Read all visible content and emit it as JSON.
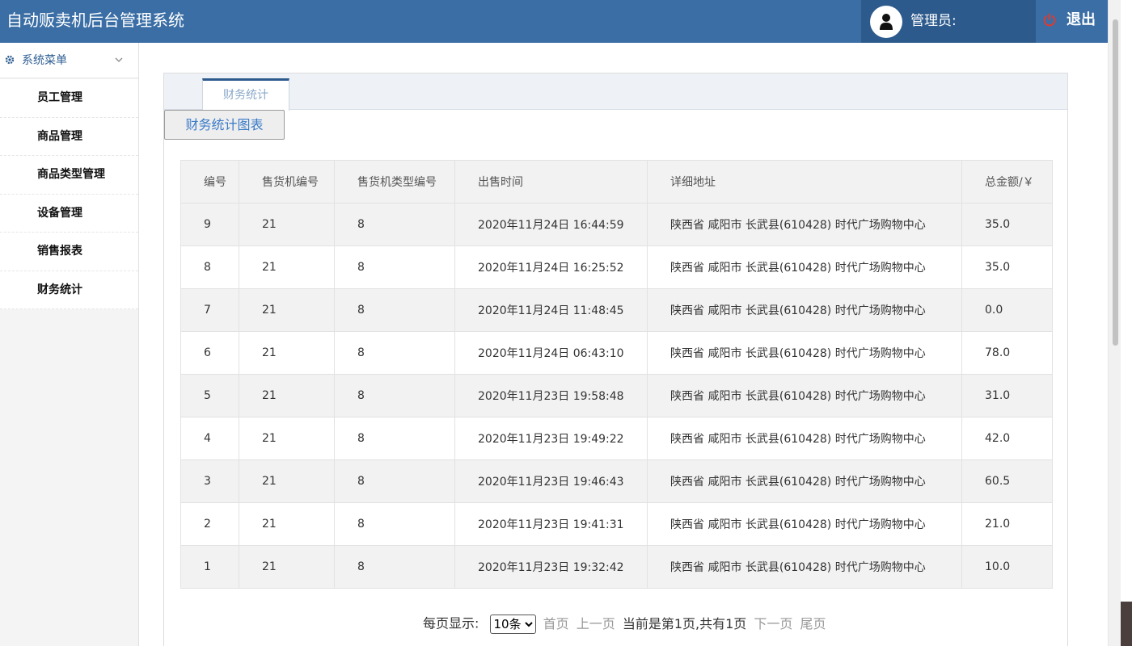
{
  "header": {
    "title": "自动贩卖机后台管理系统",
    "user_label": "管理员:",
    "logout_label": "退出"
  },
  "sidebar": {
    "menu_title": "系统菜单",
    "items": [
      {
        "label": "员工管理"
      },
      {
        "label": "商品管理"
      },
      {
        "label": "商品类型管理"
      },
      {
        "label": "设备管理"
      },
      {
        "label": "销售报表"
      },
      {
        "label": "财务统计"
      }
    ]
  },
  "tab": {
    "label": "财务统计"
  },
  "chart_button_label": "财务统计图表",
  "table": {
    "headers": [
      "编号",
      "售货机编号",
      "售货机类型编号",
      "出售时间",
      "详细地址",
      "总金额/￥"
    ],
    "rows": [
      [
        "9",
        "21",
        "8",
        "2020年11月24日 16:44:59",
        "陕西省 咸阳市 长武县(610428) 时代广场购物中心",
        "35.0"
      ],
      [
        "8",
        "21",
        "8",
        "2020年11月24日 16:25:52",
        "陕西省 咸阳市 长武县(610428) 时代广场购物中心",
        "35.0"
      ],
      [
        "7",
        "21",
        "8",
        "2020年11月24日 11:48:45",
        "陕西省 咸阳市 长武县(610428) 时代广场购物中心",
        "0.0"
      ],
      [
        "6",
        "21",
        "8",
        "2020年11月24日 06:43:10",
        "陕西省 咸阳市 长武县(610428) 时代广场购物中心",
        "78.0"
      ],
      [
        "5",
        "21",
        "8",
        "2020年11月23日 19:58:48",
        "陕西省 咸阳市 长武县(610428) 时代广场购物中心",
        "31.0"
      ],
      [
        "4",
        "21",
        "8",
        "2020年11月23日 19:49:22",
        "陕西省 咸阳市 长武县(610428) 时代广场购物中心",
        "42.0"
      ],
      [
        "3",
        "21",
        "8",
        "2020年11月23日 19:46:43",
        "陕西省 咸阳市 长武县(610428) 时代广场购物中心",
        "60.5"
      ],
      [
        "2",
        "21",
        "8",
        "2020年11月23日 19:41:31",
        "陕西省 咸阳市 长武县(610428) 时代广场购物中心",
        "21.0"
      ],
      [
        "1",
        "21",
        "8",
        "2020年11月23日 19:32:42",
        "陕西省 咸阳市 长武县(610428) 时代广场购物中心",
        "10.0"
      ]
    ]
  },
  "pagination": {
    "per_page_label": "每页显示:",
    "per_page_value": "10条",
    "first": "首页",
    "prev": "上一页",
    "status": "当前是第1页,共有1页",
    "next": "下一页",
    "last": "尾页"
  },
  "colors": {
    "header_bg": "#3a6ea5",
    "user_block_bg": "#2d5a8c",
    "accent_link": "#3a7bc8",
    "power_icon": "#e03a2e"
  },
  "icons": {
    "avatar": "user-icon",
    "logout": "power-icon",
    "menu": "gear-icon",
    "menu_toggle": "chevron-down-icon"
  }
}
